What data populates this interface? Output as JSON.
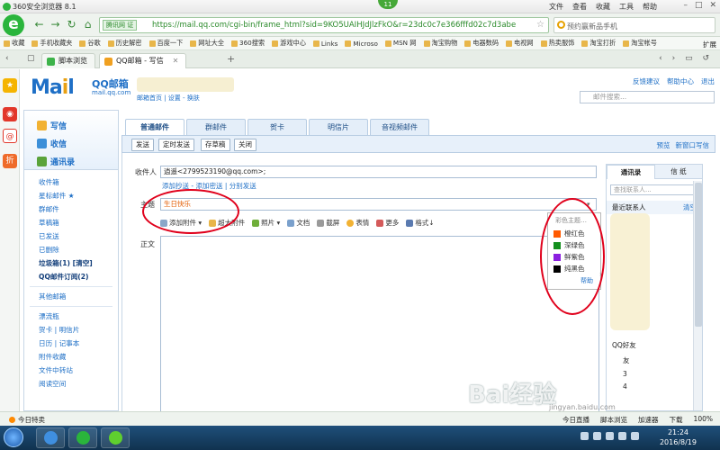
{
  "browser": {
    "title": "360安全浏览器 8.1",
    "badge": "11",
    "menus": [
      "文件",
      "查看",
      "收藏",
      "工具",
      "帮助"
    ],
    "secure_label": "腾讯网 证",
    "url": "https://mail.qq.com/cgi-bin/frame_html?sid=9KO5UAIHJdJlzFkO&r=23dc0c7e366fffd02c7d3abe",
    "search_placeholder": "预约赢新品手机",
    "bookmarks": [
      "收藏",
      "手机收藏夹",
      "谷歌",
      "历史解密",
      "百度一下",
      "网址大全",
      "360搜索",
      "游戏中心",
      "Links",
      "Microso",
      "MSN 网",
      "淘宝购物",
      "电器数码",
      "电视网",
      "热卖服饰",
      "淘宝打折",
      "淘宝帐号"
    ],
    "extensions_label": "扩展",
    "tabs": [
      "脚本浏览",
      "QQ邮箱 - 写信"
    ],
    "status_left": "今日特卖",
    "status_right": [
      "今日直播",
      "脚本浏览",
      "加速器",
      "下载"
    ],
    "zoom": "100%"
  },
  "qqmail": {
    "logo_text": "Mail",
    "brand": "QQ邮箱",
    "site": "mail.qq.com",
    "account_links": "邮箱首页 | 设置 - 换肤",
    "top_links": [
      "反馈建议",
      "帮助中心",
      "退出"
    ],
    "search_placeholder": "邮件搜索...",
    "nav_main": [
      "写信",
      "收信",
      "通讯录"
    ],
    "nav_items": [
      "收件箱",
      "星标邮件 ★",
      "群邮件",
      "草稿箱",
      "已发送",
      "已删除",
      "垃圾箱(1)  [清空]",
      "QQ邮件订阅(2)"
    ],
    "nav_items2": [
      "其他邮箱"
    ],
    "nav_items3": [
      "漂流瓶",
      "贺卡 | 明信片",
      "日历 | 记事本",
      "附件收藏",
      "文件中转站",
      "阅读空间"
    ],
    "mail_tabs": [
      "普通邮件",
      "群邮件",
      "贺卡",
      "明信片",
      "音视频邮件"
    ],
    "buttons": [
      "发送",
      "定时发送",
      "存草稿",
      "关闭"
    ],
    "toolbar_right": [
      "预览",
      "新窗口写信"
    ],
    "to_label": "收件人",
    "to_value": "逍遥<2799523190@qq.com>;",
    "to_links": "添加抄送 - 添加密送 | 分别发送",
    "subject_label": "主题",
    "subject_value": "生日快乐",
    "body_label": "正文",
    "format_tools": [
      "添加附件 ▾",
      "超大附件",
      "照片 ▾",
      "文档",
      "截屏",
      "表情",
      "更多",
      "格式↓"
    ],
    "color_menu": {
      "header": "彩色主题…",
      "options": [
        {
          "label": "橙红色",
          "color": "#ff5a00"
        },
        {
          "label": "深绿色",
          "color": "#138f1e"
        },
        {
          "label": "鲜紫色",
          "color": "#8b1fe0"
        },
        {
          "label": "纯黑色",
          "color": "#000000"
        }
      ],
      "help": "帮助"
    },
    "contacts": {
      "tabs": [
        "通讯录",
        "信 纸"
      ],
      "search_placeholder": "查找联系人...",
      "recent": "最近联系人",
      "clear": "清空",
      "friends": "QQ好友",
      "friend_rows": [
        "友",
        "3",
        "4"
      ]
    }
  },
  "taskbar": {
    "time": "21:24",
    "date": "2016/8/19"
  },
  "watermark": {
    "logo": "Bai经验",
    "site": "jingyan.baidu.com"
  }
}
